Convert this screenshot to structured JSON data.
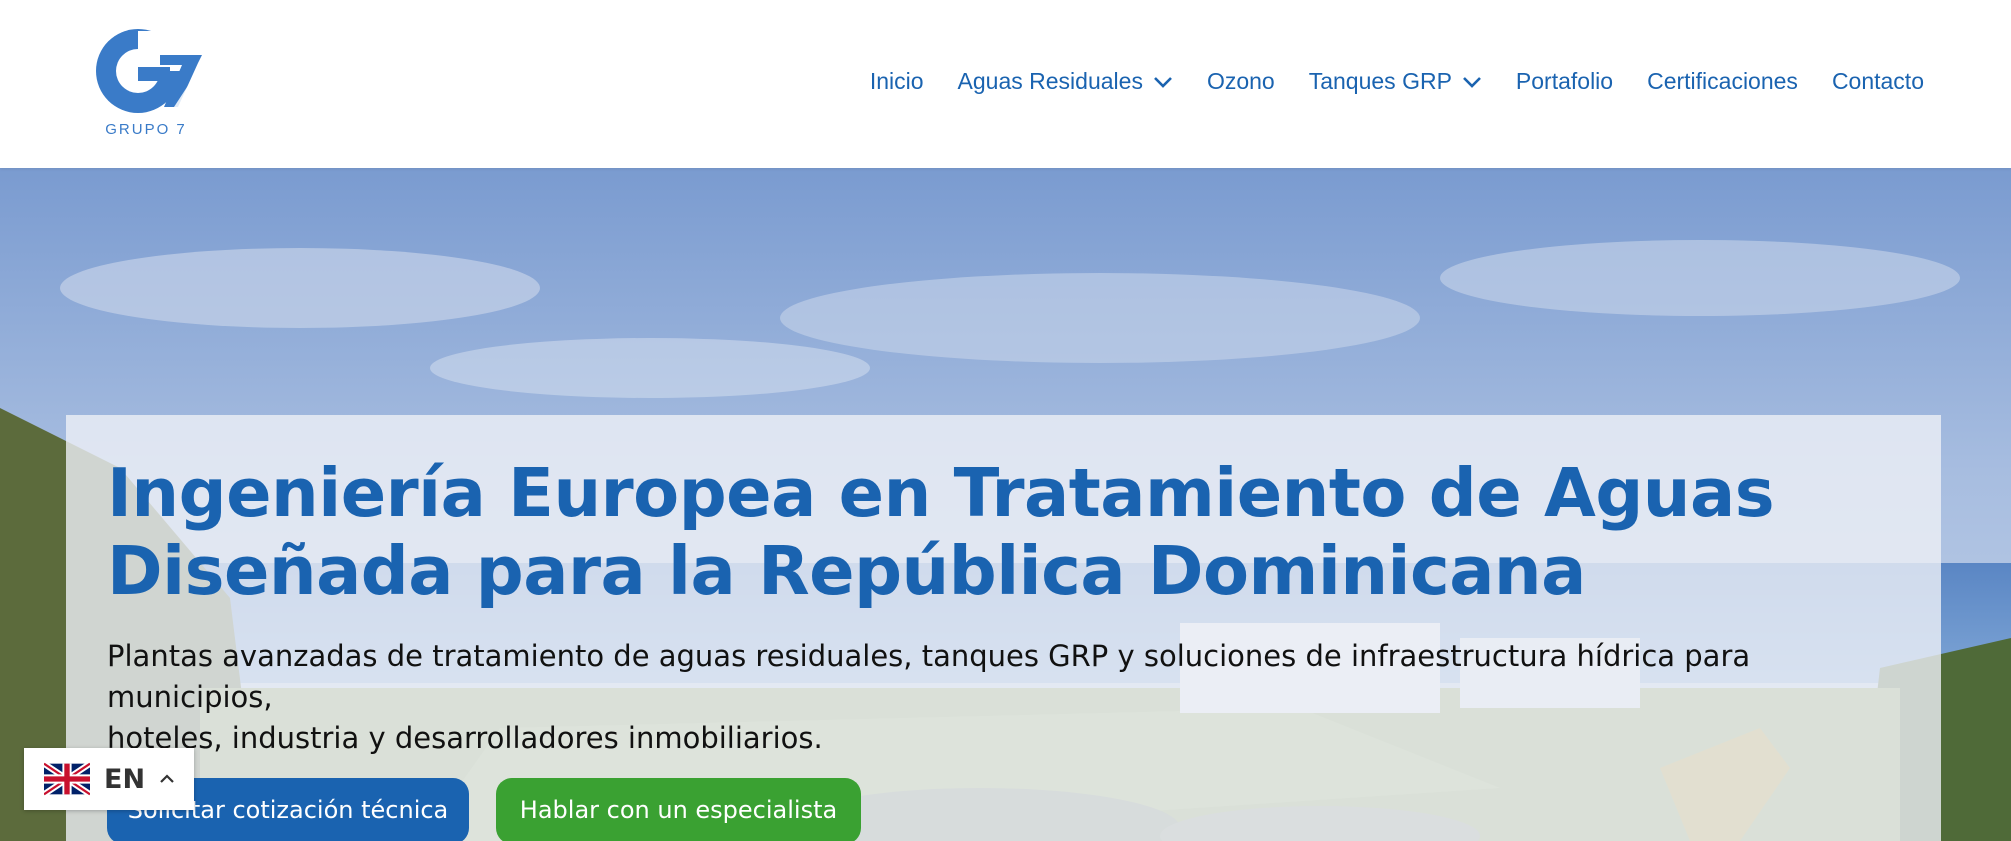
{
  "header": {
    "logo_text": "GRUPO 7",
    "nav": [
      {
        "label": "Inicio",
        "has_dropdown": false
      },
      {
        "label": "Aguas Residuales",
        "has_dropdown": true
      },
      {
        "label": "Ozono",
        "has_dropdown": false
      },
      {
        "label": "Tanques GRP",
        "has_dropdown": true
      },
      {
        "label": "Portafolio",
        "has_dropdown": false
      },
      {
        "label": "Certificaciones",
        "has_dropdown": false
      },
      {
        "label": "Contacto",
        "has_dropdown": false
      }
    ]
  },
  "hero": {
    "title_line1": "Ingeniería Europea en Tratamiento de Aguas",
    "title_line2": "Diseñada para la República Dominicana",
    "subtitle_line1": "Plantas avanzadas de tratamiento de aguas residuales, tanques GRP y soluciones de infraestructura hídrica para municipios,",
    "subtitle_line2": "hoteles, industria y desarrolladores inmobiliarios.",
    "primary_cta": "Solicitar cotización técnica",
    "secondary_cta": "Hablar con un especialista"
  },
  "language_switcher": {
    "code": "EN",
    "flag_icon": "uk-flag-icon",
    "caret_icon": "chevron-up-icon"
  },
  "colors": {
    "brand_blue": "#1a63b0",
    "cta_green": "#3aa132",
    "text_dark": "#111111"
  }
}
